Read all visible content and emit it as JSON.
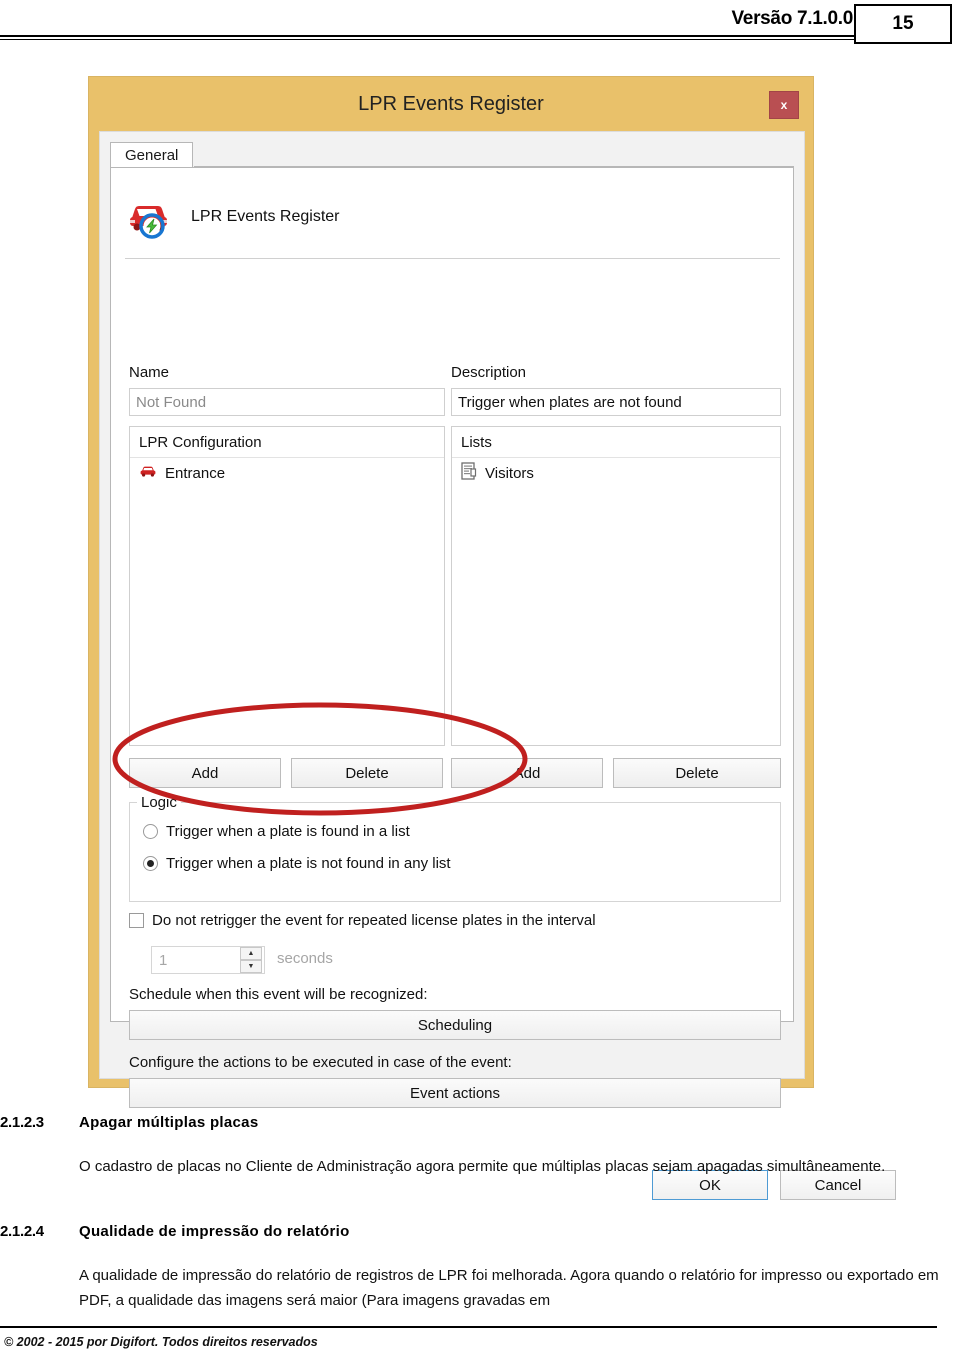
{
  "page_header": {
    "version": "Versão 7.1.0.0",
    "page_number": "15"
  },
  "dialog": {
    "title": "LPR Events Register",
    "close_label": "x",
    "tabs": [
      {
        "label": "General"
      }
    ],
    "header_item": {
      "icon": "lpr-car-event-icon",
      "label": "LPR Events Register"
    },
    "fields": {
      "name_label": "Name",
      "name_value": "Not Found",
      "description_label": "Description",
      "description_value": "Trigger when plates are not found"
    },
    "lpr_configuration": {
      "header": "LPR Configuration",
      "items": [
        {
          "label": "Entrance",
          "icon": "car-icon"
        }
      ],
      "add_label": "Add",
      "delete_label": "Delete"
    },
    "lists": {
      "header": "Lists",
      "items": [
        {
          "label": "Visitors",
          "icon": "document-list-icon"
        }
      ],
      "add_label": "Add",
      "delete_label": "Delete"
    },
    "logic": {
      "caption": "Logic",
      "options": [
        {
          "label": "Trigger when a plate is found in a list",
          "selected": false
        },
        {
          "label": "Trigger when a plate is not found in any list",
          "selected": true
        }
      ]
    },
    "retrigger": {
      "checkbox_label": "Do not retrigger the event for repeated license plates in the interval",
      "checked": false,
      "interval_value": "1",
      "unit_label": "seconds"
    },
    "schedule": {
      "label": "Schedule when this event will be recognized:",
      "button_label": "Scheduling"
    },
    "actions": {
      "label": "Configure the actions to be executed in case of the event:",
      "button_label": "Event actions"
    },
    "footer_buttons": {
      "ok_label": "OK",
      "cancel_label": "Cancel"
    },
    "colors": {
      "frame": "#e9c16a",
      "close_button": "#b94f52",
      "annotation": "#c0201f",
      "ok_focus_border": "#4e9bd4"
    }
  },
  "annotation": {
    "shape": "red-ellipse-highlight",
    "target": "logic-radio-group"
  },
  "document": {
    "sections": [
      {
        "number": "2.1.2.3",
        "heading": "Apagar múltiplas placas",
        "paragraph": "O cadastro de placas no Cliente de Administração agora permite que múltiplas placas sejam apagadas simultâneamente."
      },
      {
        "number": "2.1.2.4",
        "heading": "Qualidade de impressão do relatório",
        "paragraph": "A qualidade de impressão do relatório de registros de LPR foi melhorada. Agora quando o relatório for impresso ou exportado em PDF, a qualidade das imagens será maior (Para imagens gravadas em"
      }
    ],
    "footer": "© 2002 - 2015 por Digifort. Todos direitos reservados"
  }
}
